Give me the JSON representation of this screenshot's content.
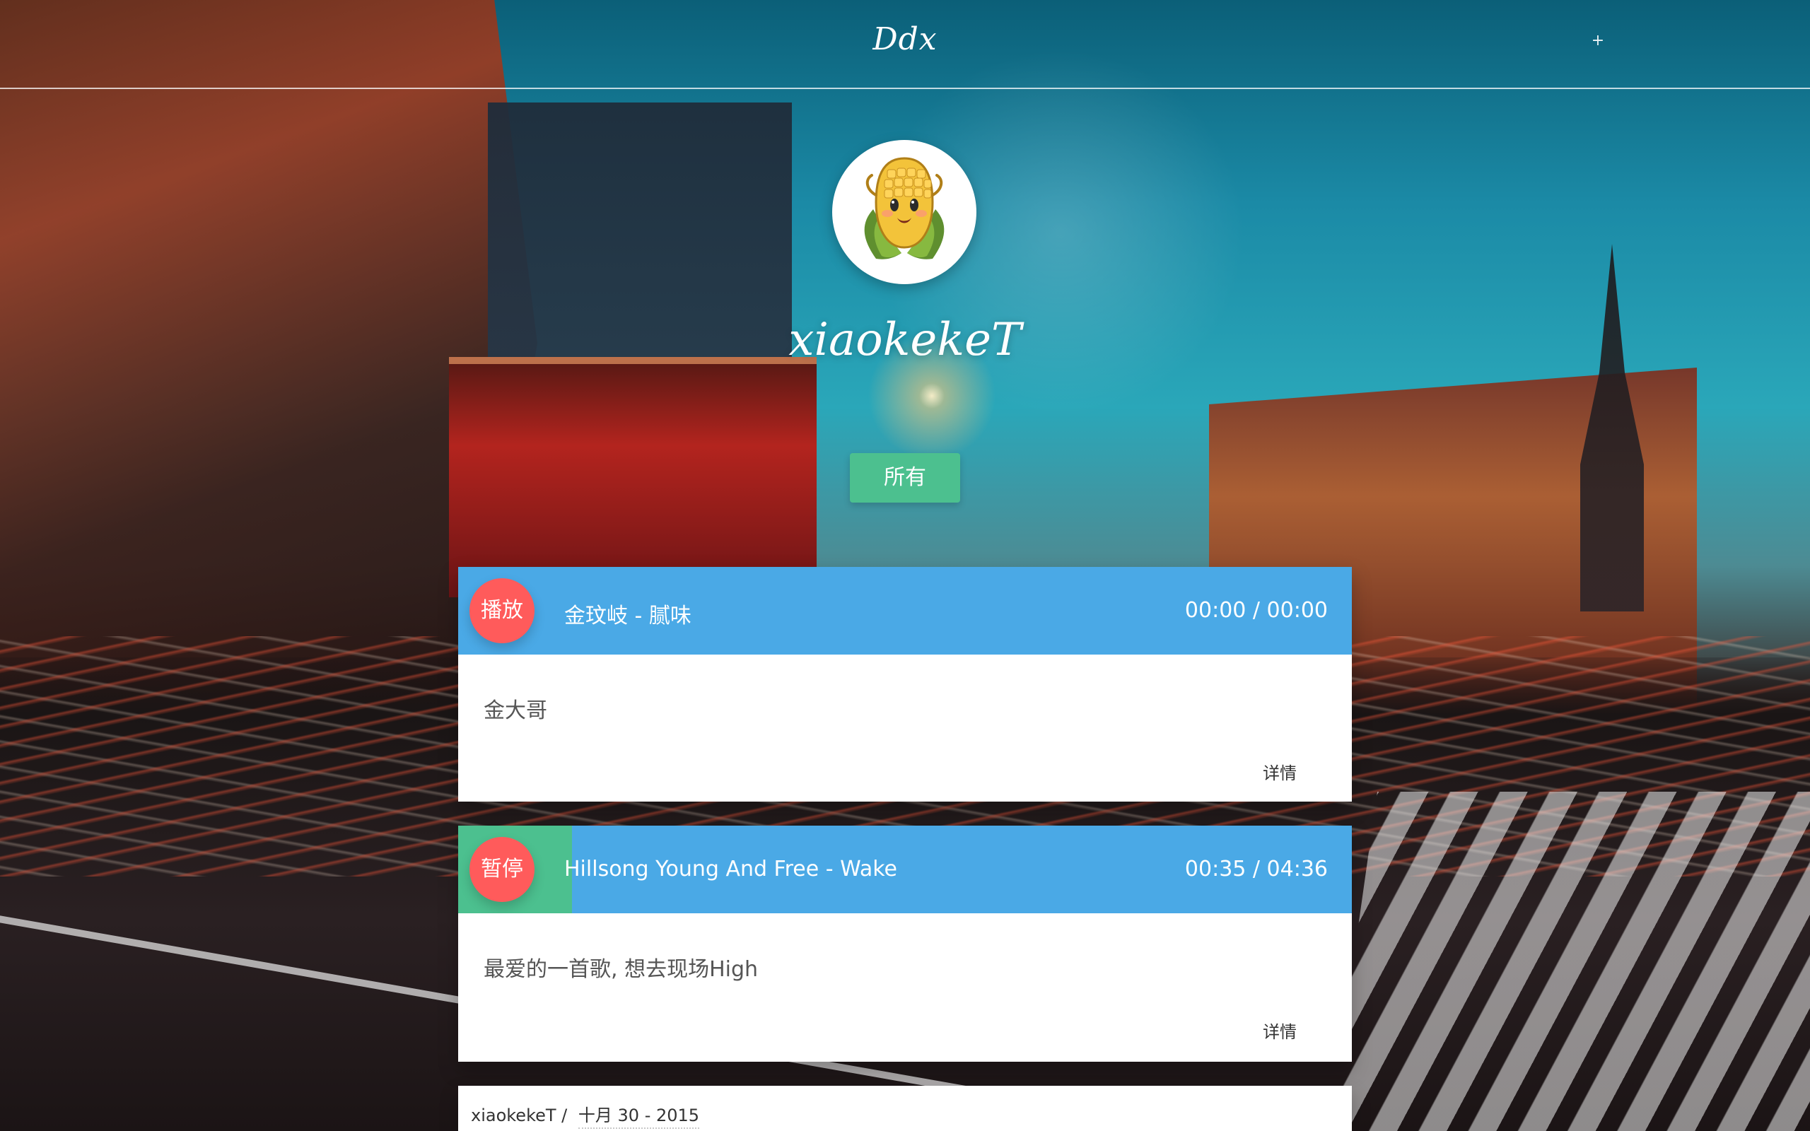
{
  "header": {
    "brand": "Ddx",
    "plus": "+"
  },
  "profile": {
    "username": "xiaokekeT",
    "filter_label": "所有"
  },
  "posts": [
    {
      "player_button": "播放",
      "track_title": "金玟岐 - 腻味",
      "time": "00:00 / 00:00",
      "progress": 0.0,
      "content": "金大哥",
      "details_label": "详情"
    },
    {
      "player_button": "暂停",
      "track_title": "Hillsong Young And Free - Wake",
      "time": "00:35 / 04:36",
      "progress": 0.127,
      "content": "最爱的一首歌, 想去现场High",
      "details_label": "详情"
    }
  ],
  "footer_meta": {
    "author": "xiaokekeT /",
    "date": "十月 30 - 2015"
  },
  "colors": {
    "player_blue": "#4aa9e6",
    "progress_green": "#4cc08f",
    "play_red": "#ff5b5b",
    "button_green": "#4cc08f"
  }
}
